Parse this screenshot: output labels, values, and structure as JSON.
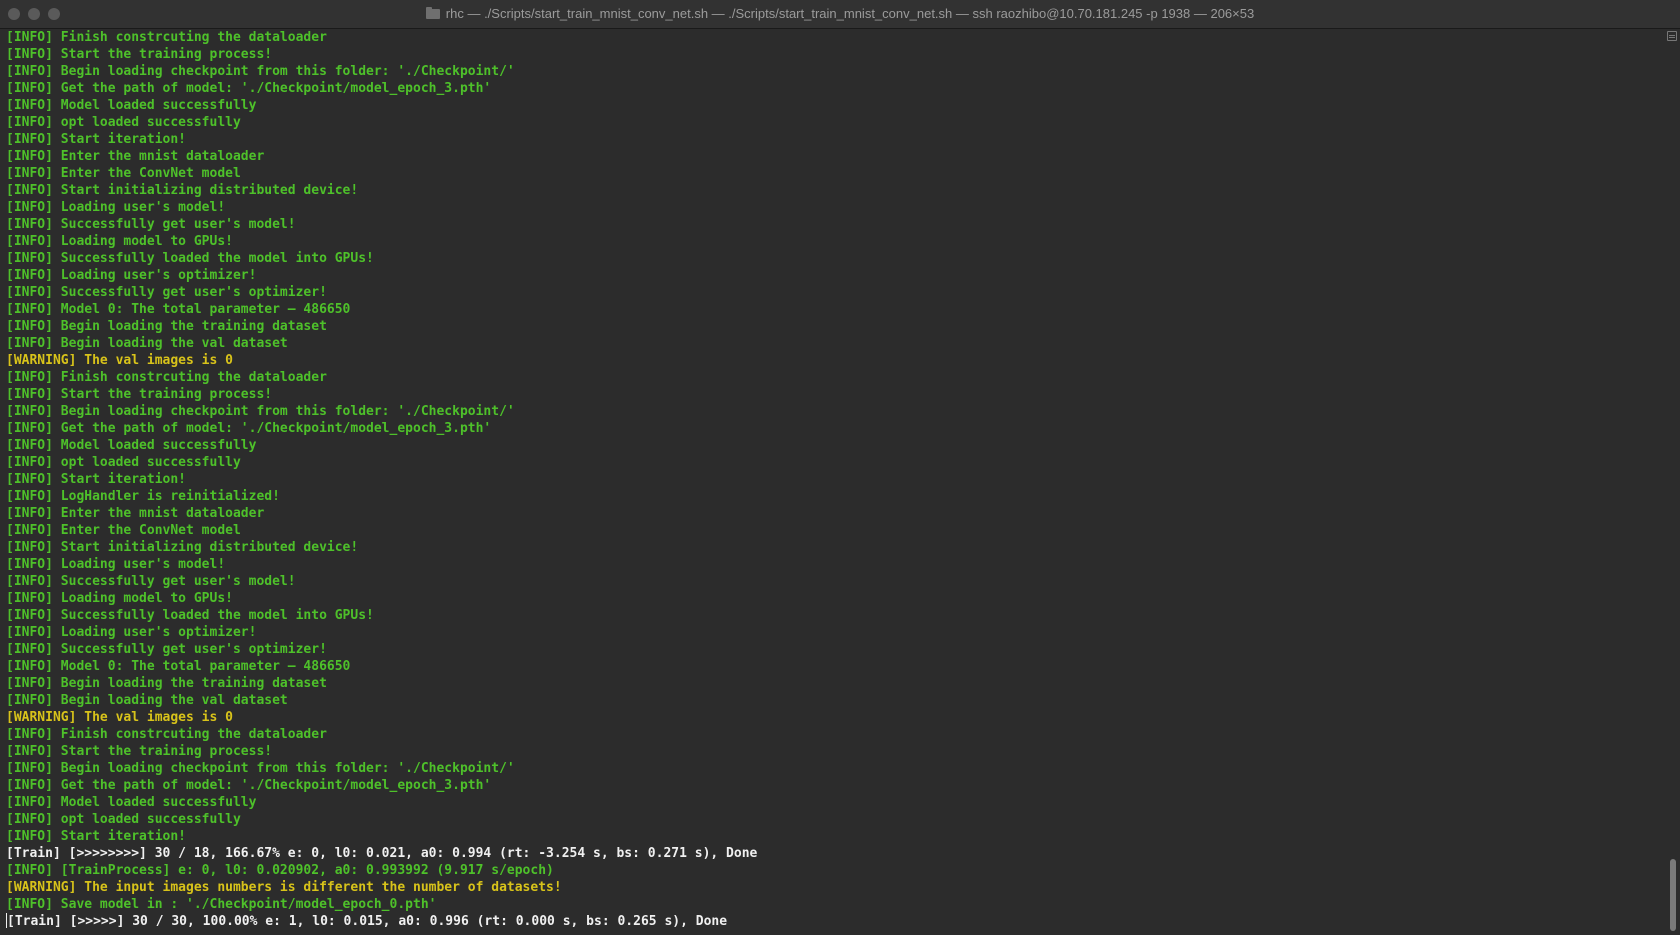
{
  "window": {
    "title": "rhc — ./Scripts/start_train_mnist_conv_net.sh — ./Scripts/start_train_mnist_conv_net.sh — ssh raozhibo@10.70.181.245 -p 1938 — 206×53"
  },
  "colors": {
    "info": "#4ec12a",
    "warning": "#d8c31a",
    "train": "#f0f0f0",
    "background": "#2c2c2c"
  },
  "terminal": {
    "lines": [
      {
        "text": "[INFO] Finish constrcuting the dataloader",
        "level": "info"
      },
      {
        "text": "[INFO] Start the training process!",
        "level": "info"
      },
      {
        "text": "[INFO] Begin loading checkpoint from this folder: './Checkpoint/'",
        "level": "info"
      },
      {
        "text": "[INFO] Get the path of model: './Checkpoint/model_epoch_3.pth'",
        "level": "info"
      },
      {
        "text": "[INFO] Model loaded successfully",
        "level": "info"
      },
      {
        "text": "[INFO] opt loaded successfully",
        "level": "info"
      },
      {
        "text": "[INFO] Start iteration!",
        "level": "info"
      },
      {
        "text": "[INFO] Enter the mnist dataloader",
        "level": "info"
      },
      {
        "text": "[INFO] Enter the ConvNet model",
        "level": "info"
      },
      {
        "text": "[INFO] Start initializing distributed device!",
        "level": "info"
      },
      {
        "text": "[INFO] Loading user's model!",
        "level": "info"
      },
      {
        "text": "[INFO] Successfully get user's model!",
        "level": "info"
      },
      {
        "text": "[INFO] Loading model to GPUs!",
        "level": "info"
      },
      {
        "text": "[INFO] Successfully loaded the model into GPUs!",
        "level": "info"
      },
      {
        "text": "[INFO] Loading user's optimizer!",
        "level": "info"
      },
      {
        "text": "[INFO] Successfully get user's optimizer!",
        "level": "info"
      },
      {
        "text": "[INFO] Model 0: The total parameter – 486650",
        "level": "info"
      },
      {
        "text": "[INFO] Begin loading the training dataset",
        "level": "info"
      },
      {
        "text": "[INFO] Begin loading the val dataset",
        "level": "info"
      },
      {
        "text": "[WARNING] The val images is 0",
        "level": "warning"
      },
      {
        "text": "[INFO] Finish constrcuting the dataloader",
        "level": "info"
      },
      {
        "text": "[INFO] Start the training process!",
        "level": "info"
      },
      {
        "text": "[INFO] Begin loading checkpoint from this folder: './Checkpoint/'",
        "level": "info"
      },
      {
        "text": "[INFO] Get the path of model: './Checkpoint/model_epoch_3.pth'",
        "level": "info"
      },
      {
        "text": "[INFO] Model loaded successfully",
        "level": "info"
      },
      {
        "text": "[INFO] opt loaded successfully",
        "level": "info"
      },
      {
        "text": "[INFO] Start iteration!",
        "level": "info"
      },
      {
        "text": "[INFO] LogHandler is reinitialized!",
        "level": "info"
      },
      {
        "text": "[INFO] Enter the mnist dataloader",
        "level": "info"
      },
      {
        "text": "[INFO] Enter the ConvNet model",
        "level": "info"
      },
      {
        "text": "[INFO] Start initializing distributed device!",
        "level": "info"
      },
      {
        "text": "[INFO] Loading user's model!",
        "level": "info"
      },
      {
        "text": "[INFO] Successfully get user's model!",
        "level": "info"
      },
      {
        "text": "[INFO] Loading model to GPUs!",
        "level": "info"
      },
      {
        "text": "[INFO] Successfully loaded the model into GPUs!",
        "level": "info"
      },
      {
        "text": "[INFO] Loading user's optimizer!",
        "level": "info"
      },
      {
        "text": "[INFO] Successfully get user's optimizer!",
        "level": "info"
      },
      {
        "text": "[INFO] Model 0: The total parameter – 486650",
        "level": "info"
      },
      {
        "text": "[INFO] Begin loading the training dataset",
        "level": "info"
      },
      {
        "text": "[INFO] Begin loading the val dataset",
        "level": "info"
      },
      {
        "text": "[WARNING] The val images is 0",
        "level": "warning"
      },
      {
        "text": "[INFO] Finish constrcuting the dataloader",
        "level": "info"
      },
      {
        "text": "[INFO] Start the training process!",
        "level": "info"
      },
      {
        "text": "[INFO] Begin loading checkpoint from this folder: './Checkpoint/'",
        "level": "info"
      },
      {
        "text": "[INFO] Get the path of model: './Checkpoint/model_epoch_3.pth'",
        "level": "info"
      },
      {
        "text": "[INFO] Model loaded successfully",
        "level": "info"
      },
      {
        "text": "[INFO] opt loaded successfully",
        "level": "info"
      },
      {
        "text": "[INFO] Start iteration!",
        "level": "info"
      },
      {
        "text": "[Train] [>>>>>>>>] 30 / 18, 166.67% e: 0, l0: 0.021, a0: 0.994 (rt: -3.254 s, bs: 0.271 s), Done",
        "level": "train"
      },
      {
        "text": "[INFO] [TrainProcess] e: 0, l0: 0.020902, a0: 0.993992 (9.917 s/epoch)",
        "level": "info"
      },
      {
        "text": "[WARNING] The input images numbers is different the number of datasets!",
        "level": "warning"
      },
      {
        "text": "[INFO] Save model in : './Checkpoint/model_epoch_0.pth'",
        "level": "info"
      },
      {
        "text": "[Train] [>>>>>] 30 / 30, 100.00% e: 1, l0: 0.015, a0: 0.996 (rt: 0.000 s, bs: 0.265 s), Done",
        "level": "train"
      }
    ]
  }
}
